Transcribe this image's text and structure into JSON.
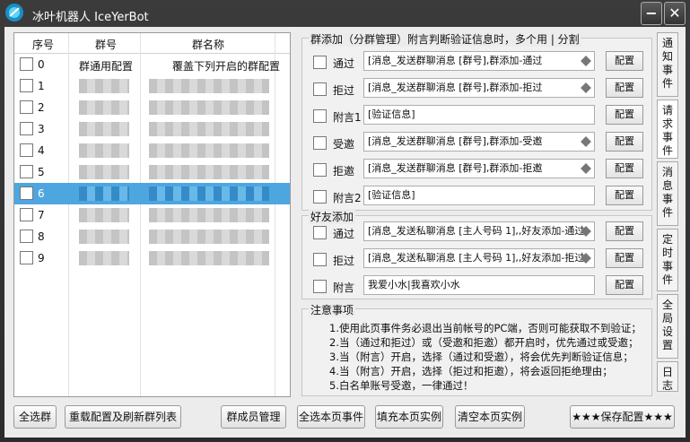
{
  "app": {
    "title": "冰叶机器人 IceYerBot"
  },
  "window_controls": {
    "minimize": "−",
    "close": "✕"
  },
  "table": {
    "headers": [
      "序号",
      "群号",
      "群名称"
    ],
    "rows": [
      {
        "num": "0",
        "group_id": "群通用配置",
        "group_name": "覆盖下列开启的群配置",
        "selected": false
      },
      {
        "num": "1",
        "group_id": "",
        "group_name": "",
        "selected": false
      },
      {
        "num": "2",
        "group_id": "",
        "group_name": "",
        "selected": false
      },
      {
        "num": "3",
        "group_id": "",
        "group_name": "",
        "selected": false
      },
      {
        "num": "4",
        "group_id": "",
        "group_name": "",
        "selected": false
      },
      {
        "num": "5",
        "group_id": "",
        "group_name": "",
        "selected": false
      },
      {
        "num": "6",
        "group_id": "",
        "group_name": "",
        "selected": true
      },
      {
        "num": "7",
        "group_id": "",
        "group_name": "",
        "selected": false
      },
      {
        "num": "8",
        "group_id": "",
        "group_name": "",
        "selected": false
      },
      {
        "num": "9",
        "group_id": "",
        "group_name": "",
        "selected": false
      }
    ]
  },
  "group_add": {
    "title": "群添加（分群管理）附言判断验证信息时，多个用 | 分割",
    "options": [
      {
        "label": "通过",
        "value": "[消息_发送群聊消息 [群号],群添加-通过",
        "config": "配置"
      },
      {
        "label": "拒过",
        "value": "[消息_发送群聊消息 [群号],群添加-拒过",
        "config": "配置"
      },
      {
        "label": "附言1",
        "value": "[验证信息]",
        "config": "配置"
      },
      {
        "label": "受邀",
        "value": "[消息_发送群聊消息 [群号],群添加-受邀",
        "config": "配置"
      },
      {
        "label": "拒邀",
        "value": "[消息_发送群聊消息 [群号],群添加-拒邀",
        "config": "配置"
      },
      {
        "label": "附言2",
        "value": "[验证信息]",
        "config": "配置"
      }
    ]
  },
  "friend_add": {
    "title": "好友添加",
    "options": [
      {
        "label": "通过",
        "value": "[消息_发送私聊消息 [主人号码 1],,好友添加-通过",
        "config": "配置"
      },
      {
        "label": "拒过",
        "value": "[消息_发送私聊消息 [主人号码 1],,好友添加-拒过",
        "config": "配置"
      },
      {
        "label": "附言",
        "value": "我爱小水|我喜欢小水",
        "config": "配置"
      }
    ]
  },
  "notes": {
    "title": "注意事项",
    "lines": [
      "1.使用此页事件务必退出当前帐号的PC端，否则可能获取不到验证；",
      "2.当（通过和拒过）或（受邀和拒邀）都开启时，优先通过或受邀；",
      "3.当（附言）开启，选择（通过和受邀），将会优先判断验证信息；",
      "4.当（附言）开启，选择（拒过和拒邀），将会返回拒绝理由；",
      "5.白名单账号受邀，一律通过！"
    ]
  },
  "side_tabs": [
    "通知事件",
    "请求事件",
    "消息事件",
    "定时事件",
    "全局设置",
    "日志"
  ],
  "buttons": {
    "select_all_groups": "全选群",
    "reload": "重载配置及刷新群列表",
    "member_manage": "群成员管理",
    "select_all_page": "全选本页事件",
    "fill_page": "填充本页实例",
    "clear_page": "清空本页实例",
    "save": "★★★保存配置★★★"
  }
}
